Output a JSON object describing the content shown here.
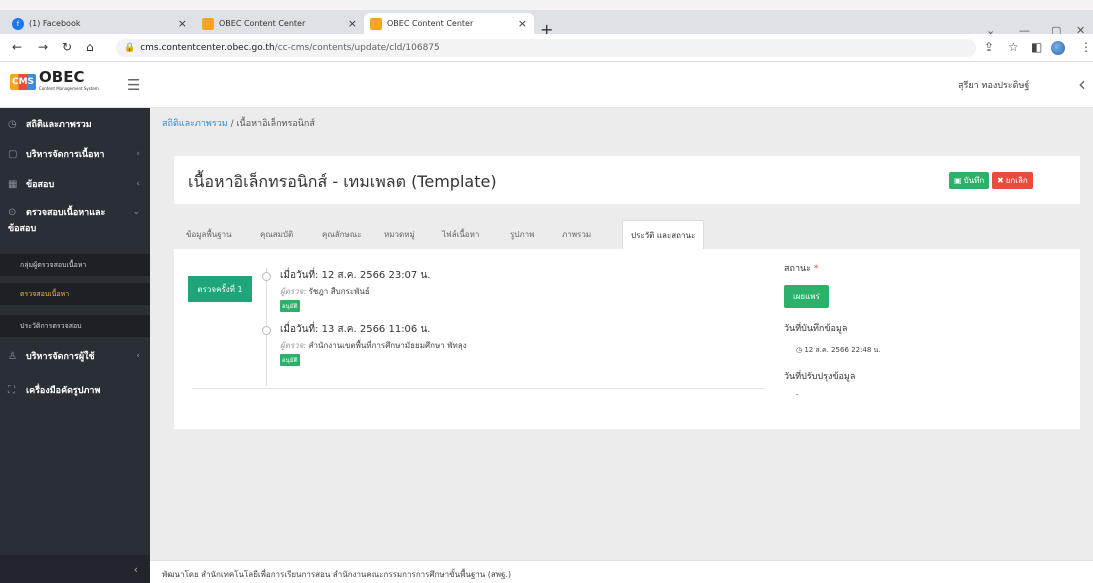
{
  "browser": {
    "tabs": [
      {
        "title": "(1) Facebook"
      },
      {
        "title": "OBEC Content Center"
      },
      {
        "title": "OBEC Content Center"
      }
    ],
    "url_host": "cms.contentcenter.obec.go.th",
    "url_path": "/cc-cms/contents/update/cld/106875"
  },
  "header": {
    "logo_badge": "CMS",
    "logo_title": "OBEC",
    "logo_subtitle": "Content Management System",
    "username": "สุรียา ทองประดิษฐ์"
  },
  "sidebar": {
    "items": [
      {
        "label": "สถิติและภาพรวม"
      },
      {
        "label": "บริหารจัดการเนื้อหา"
      },
      {
        "label": "ข้อสอบ"
      },
      {
        "label": "ตรวจสอบเนื้อหาและ"
      },
      {
        "label": "ข้อสอบ"
      },
      {
        "label": "บริหารจัดการผู้ใช้"
      },
      {
        "label": "เครื่องมือคัดรูปภาพ"
      }
    ],
    "subitems": [
      {
        "label": "กลุ่มผู้ตรวจสอบเนื้อหา"
      },
      {
        "label": "ตรวจสอบเนื้อหา"
      },
      {
        "label": "ประวัติการตรวจสอบ"
      }
    ]
  },
  "breadcrumb": {
    "link": "สถิติและภาพรวม",
    "sep": "/",
    "current": "เนื้อหาอิเล็กทรอนิกส์"
  },
  "page": {
    "title": "เนื้อหาอิเล็กทรอนิกส์ - เทมเพลต (Template)",
    "save_label": "บันทึก",
    "cancel_label": "ยกเลิก"
  },
  "tabs": [
    {
      "label": "ข้อมูลพื้นฐาน"
    },
    {
      "label": "คุณสมบัติ"
    },
    {
      "label": "คุณลักษณะ"
    },
    {
      "label": "หมวดหมู่"
    },
    {
      "label": "ไฟล์เนื้อหา"
    },
    {
      "label": "รูปภาพ"
    },
    {
      "label": "ภาพรวม"
    },
    {
      "label": "ประวัติ และสถานะ"
    }
  ],
  "history": {
    "badge": "ตรวจครั้งที่ 1",
    "entries": [
      {
        "date": "เมื่อวันที่: 12 ส.ค. 2566 23:07 น.",
        "reviewer_prefix": "ผู้ตรวจ:",
        "reviewer": "รัชฎา สืบกระพันธ์",
        "tag": "อนุมัติ"
      },
      {
        "date": "เมื่อวันที่: 13 ส.ค. 2566 11:06 น.",
        "reviewer_prefix": "ผู้ตรวจ:",
        "reviewer": "สำนักงานเขตพื้นที่การศึกษามัธยมศึกษา พัทลุง",
        "tag": "อนุมัติ"
      }
    ]
  },
  "status": {
    "label": "สถานะ",
    "required_mark": "*",
    "value": "เผยแพร่",
    "created_label": "วันที่บันทึกข้อมูล",
    "created_value": "12 ส.ค. 2566 22:48 น.",
    "updated_label": "วันที่ปรับปรุงข้อมูล",
    "updated_value": "-"
  },
  "footer": {
    "text": "พัฒนาโดย  สำนักเทคโนโลยีเพื่อการเรียนการสอน สำนักงานคณะกรรมการการศึกษาขั้นพื้นฐาน (สพฐ.)"
  },
  "colors": {
    "sidebar": "#2a2e35",
    "accent_green": "#2bb169",
    "teal_badge": "#1fa57c",
    "danger": "#e74c3c",
    "link": "#2e8ad8"
  }
}
